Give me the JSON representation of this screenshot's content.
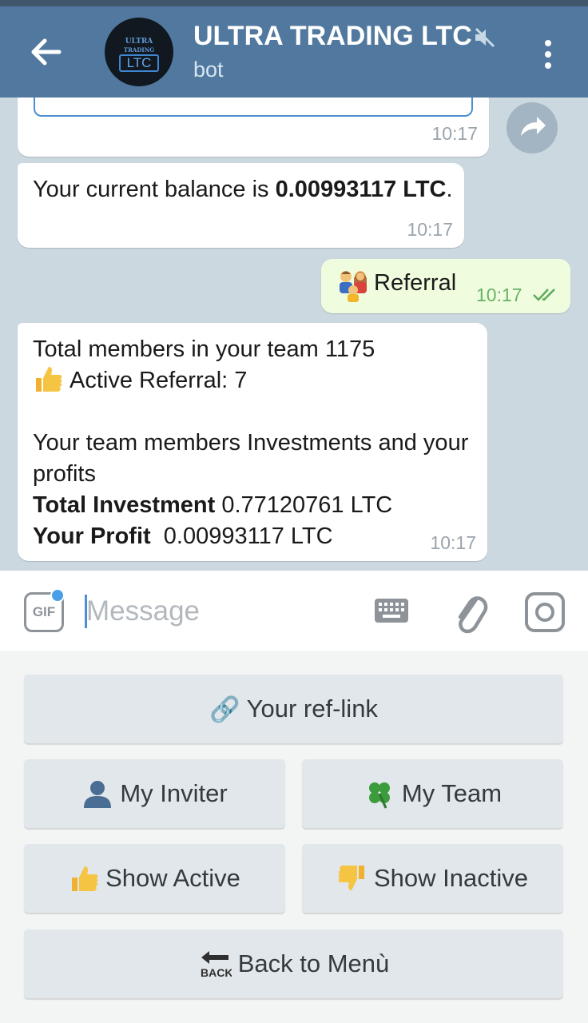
{
  "header": {
    "title": "ULTRA TRADING LTC",
    "subtitle": "bot",
    "avatar": {
      "line1": "ULTRA",
      "line2": "TRADING",
      "line3": "LTC"
    }
  },
  "messages": {
    "m1": {
      "time": "10:17"
    },
    "m2": {
      "text_prefix": "Your current balance is ",
      "balance_bold": "0.00993117 LTC",
      "text_suffix": ".",
      "time": "10:17"
    },
    "m3": {
      "label": "Referral",
      "time": "10:17"
    },
    "m4": {
      "line1": "Total members in your team 1175",
      "line2": "Active Referral: 7",
      "line3": "Your team members Investments and your profits",
      "investment_label": "Total Investment",
      "investment_value": " 0.77120761 LTC",
      "profit_label": "Your Profit",
      "profit_value": "  0.00993117 LTC",
      "time": "10:17"
    }
  },
  "input": {
    "placeholder": "Message",
    "value": "",
    "gif_label": "GIF"
  },
  "keyboard": {
    "ref_link": "Your ref-link",
    "my_inviter": "My Inviter",
    "my_team": "My Team",
    "show_active": "Show Active",
    "show_inactive": "Show Inactive",
    "back_to_menu": "Back to Menù"
  },
  "icons": {
    "back": "arrow-left-icon",
    "mute": "muted-speaker-icon",
    "menu": "kebab-menu-icon",
    "share": "share-arrow-icon",
    "read": "double-check-icon",
    "keyboard": "keyboard-icon",
    "attach": "paperclip-icon",
    "camera": "camera-icon"
  },
  "colors": {
    "header_bg": "#51789e",
    "outgoing_bubble": "#effdde",
    "incoming_bubble": "#ffffff",
    "keyboard_button": "#e1e7ea",
    "accent": "#4a9fe8"
  }
}
